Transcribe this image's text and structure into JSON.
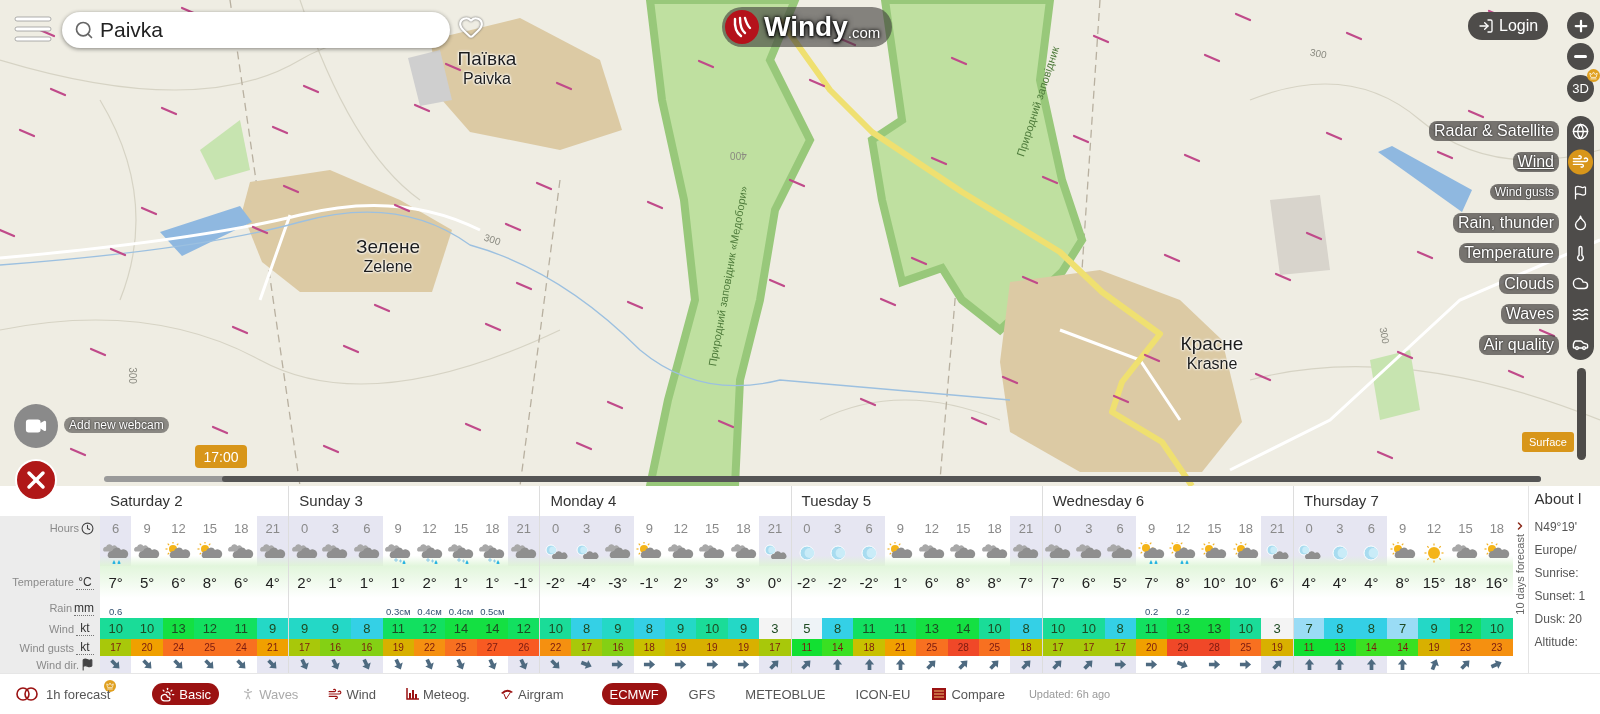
{
  "search": {
    "value": "Paivka"
  },
  "logo": {
    "name": "Windy",
    "suffix": ".com"
  },
  "login": {
    "label": "Login"
  },
  "three_d": {
    "label": "3D"
  },
  "layers": [
    {
      "label": "Radar & Satellite",
      "kind": "main",
      "selected": false
    },
    {
      "label": "Wind",
      "kind": "main",
      "selected": true
    },
    {
      "label": "Wind gusts",
      "kind": "sub",
      "selected": false
    },
    {
      "label": "Rain, thunder",
      "kind": "main",
      "selected": false
    },
    {
      "label": "Temperature",
      "kind": "main",
      "selected": false
    },
    {
      "label": "Clouds",
      "kind": "main",
      "selected": false
    },
    {
      "label": "Waves",
      "kind": "main",
      "selected": false
    },
    {
      "label": "Air quality",
      "kind": "main",
      "selected": false
    }
  ],
  "altitude": {
    "label": "Surface"
  },
  "webcam": {
    "label": "Add new webcam"
  },
  "time_bubble": {
    "label": "17:00"
  },
  "map_labels": {
    "places": [
      {
        "local": "Паївка",
        "latin": "Paivka"
      },
      {
        "local": "Зелене",
        "latin": "Zelene"
      },
      {
        "local": "Красне",
        "latin": "Krasne"
      }
    ],
    "contours": [
      "300",
      "300",
      "300",
      "400",
      "300"
    ],
    "reserves": [
      "Природний заповідник «Медобори»",
      "Природний заповідник"
    ]
  },
  "forecast": {
    "row_labels": [
      {
        "label": "Hours",
        "kind": "clock"
      },
      {
        "label": "Temperature",
        "kind": "unit",
        "unit": "°C"
      },
      {
        "label": "Rain",
        "kind": "unit",
        "unit": "mm"
      },
      {
        "label": "Wind",
        "kind": "unit",
        "unit": "kt"
      },
      {
        "label": "Wind gusts",
        "kind": "unit",
        "unit": "kt"
      },
      {
        "label": "Wind dir.",
        "kind": "flag"
      }
    ],
    "more_link": "10 days forecast",
    "days": [
      {
        "label": "Saturday 2",
        "hours": [
          {
            "hour": "6",
            "weather": {
              "kind": "rain"
            },
            "temp": "7°",
            "rain": "0.6",
            "wind": "10",
            "gust": "17",
            "dir": {
              "kind": "SE"
            },
            "night": true
          },
          {
            "hour": "9",
            "weather": {
              "kind": "cloud"
            },
            "temp": "5°",
            "wind": "10",
            "gust": "20",
            "dir": {
              "kind": "SE"
            },
            "night": false
          },
          {
            "hour": "12",
            "weather": {
              "kind": "sun-cloud"
            },
            "temp": "6°",
            "wind": "13",
            "gust": "24",
            "dir": {
              "kind": "SE"
            },
            "night": false
          },
          {
            "hour": "15",
            "weather": {
              "kind": "sun-cloud"
            },
            "temp": "8°",
            "wind": "12",
            "gust": "25",
            "dir": {
              "kind": "SE"
            },
            "night": false
          },
          {
            "hour": "18",
            "weather": {
              "kind": "cloud"
            },
            "temp": "6°",
            "wind": "11",
            "gust": "24",
            "dir": {
              "kind": "SE"
            },
            "night": false
          },
          {
            "hour": "21",
            "weather": {
              "kind": "cloud"
            },
            "temp": "4°",
            "wind": "9",
            "gust": "21",
            "dir": {
              "kind": "SE"
            },
            "night": true
          }
        ]
      },
      {
        "label": "Sunday 3",
        "hours": [
          {
            "hour": "0",
            "weather": {
              "kind": "cloud"
            },
            "temp": "2°",
            "wind": "9",
            "gust": "17",
            "dir": {
              "kind": "SSE"
            },
            "night": true
          },
          {
            "hour": "3",
            "weather": {
              "kind": "cloud"
            },
            "temp": "1°",
            "wind": "9",
            "gust": "16",
            "dir": {
              "kind": "SSE"
            },
            "night": true
          },
          {
            "hour": "6",
            "weather": {
              "kind": "cloud"
            },
            "temp": "1°",
            "wind": "8",
            "gust": "16",
            "dir": {
              "kind": "SSE"
            },
            "night": true
          },
          {
            "hour": "9",
            "weather": {
              "kind": "sleet"
            },
            "temp": "1°",
            "rain": "0.3см",
            "wind": "11",
            "gust": "19",
            "dir": {
              "kind": "SSE"
            },
            "night": false
          },
          {
            "hour": "12",
            "weather": {
              "kind": "sleet"
            },
            "temp": "2°",
            "rain": "0.4см",
            "wind": "12",
            "gust": "22",
            "dir": {
              "kind": "SSE"
            },
            "night": false
          },
          {
            "hour": "15",
            "weather": {
              "kind": "sleet"
            },
            "temp": "1°",
            "rain": "0.4см",
            "wind": "14",
            "gust": "25",
            "dir": {
              "kind": "SSE"
            },
            "night": false
          },
          {
            "hour": "18",
            "weather": {
              "kind": "sleet"
            },
            "temp": "1°",
            "rain": "0.5см",
            "wind": "14",
            "gust": "27",
            "dir": {
              "kind": "SSE"
            },
            "night": false
          },
          {
            "hour": "21",
            "weather": {
              "kind": "cloud"
            },
            "temp": "-1°",
            "wind": "12",
            "gust": "26",
            "dir": {
              "kind": "SSE"
            },
            "night": true
          }
        ]
      },
      {
        "label": "Monday 4",
        "hours": [
          {
            "hour": "0",
            "weather": {
              "kind": "moon-cloud"
            },
            "temp": "-2°",
            "wind": "10",
            "gust": "22",
            "dir": {
              "kind": "SE"
            },
            "night": true
          },
          {
            "hour": "3",
            "weather": {
              "kind": "moon-cloud"
            },
            "temp": "-4°",
            "wind": "8",
            "gust": "17",
            "dir": {
              "kind": "ESE"
            },
            "night": true
          },
          {
            "hour": "6",
            "weather": {
              "kind": "cloud"
            },
            "temp": "-3°",
            "wind": "9",
            "gust": "16",
            "dir": {
              "kind": "E"
            },
            "night": true
          },
          {
            "hour": "9",
            "weather": {
              "kind": "sun-cloud"
            },
            "temp": "-1°",
            "wind": "8",
            "gust": "18",
            "dir": {
              "kind": "E"
            },
            "night": false
          },
          {
            "hour": "12",
            "weather": {
              "kind": "cloud"
            },
            "temp": "2°",
            "wind": "9",
            "gust": "19",
            "dir": {
              "kind": "E"
            },
            "night": false
          },
          {
            "hour": "15",
            "weather": {
              "kind": "cloud"
            },
            "temp": "3°",
            "wind": "10",
            "gust": "19",
            "dir": {
              "kind": "E"
            },
            "night": false
          },
          {
            "hour": "18",
            "weather": {
              "kind": "cloud"
            },
            "temp": "3°",
            "wind": "9",
            "gust": "19",
            "dir": {
              "kind": "E"
            },
            "night": false
          },
          {
            "hour": "21",
            "weather": {
              "kind": "moon-cloud"
            },
            "temp": "0°",
            "wind": "3",
            "gust": "17",
            "dir": {
              "kind": "NE"
            },
            "night": true
          }
        ]
      },
      {
        "label": "Tuesday 5",
        "hours": [
          {
            "hour": "0",
            "weather": {
              "kind": "moon"
            },
            "temp": "-2°",
            "wind": "5",
            "gust": "11",
            "dir": {
              "kind": "NE"
            },
            "night": true
          },
          {
            "hour": "3",
            "weather": {
              "kind": "moon"
            },
            "temp": "-2°",
            "wind": "8",
            "gust": "14",
            "dir": {
              "kind": "N"
            },
            "night": true
          },
          {
            "hour": "6",
            "weather": {
              "kind": "moon"
            },
            "temp": "-2°",
            "wind": "11",
            "gust": "18",
            "dir": {
              "kind": "N"
            },
            "night": true
          },
          {
            "hour": "9",
            "weather": {
              "kind": "sun-cloud"
            },
            "temp": "1°",
            "wind": "11",
            "gust": "21",
            "dir": {
              "kind": "N"
            },
            "night": false
          },
          {
            "hour": "12",
            "weather": {
              "kind": "cloud"
            },
            "temp": "6°",
            "wind": "13",
            "gust": "25",
            "dir": {
              "kind": "NE"
            },
            "night": false
          },
          {
            "hour": "15",
            "weather": {
              "kind": "cloud"
            },
            "temp": "8°",
            "wind": "14",
            "gust": "28",
            "dir": {
              "kind": "NE"
            },
            "night": false
          },
          {
            "hour": "18",
            "weather": {
              "kind": "cloud"
            },
            "temp": "8°",
            "wind": "10",
            "gust": "25",
            "dir": {
              "kind": "NE"
            },
            "night": false
          },
          {
            "hour": "21",
            "weather": {
              "kind": "cloud"
            },
            "temp": "7°",
            "wind": "8",
            "gust": "18",
            "dir": {
              "kind": "NE"
            },
            "night": true
          }
        ]
      },
      {
        "label": "Wednesday 6",
        "hours": [
          {
            "hour": "0",
            "weather": {
              "kind": "cloud"
            },
            "temp": "7°",
            "wind": "10",
            "gust": "17",
            "dir": {
              "kind": "NE"
            },
            "night": true
          },
          {
            "hour": "3",
            "weather": {
              "kind": "cloud"
            },
            "temp": "6°",
            "wind": "10",
            "gust": "17",
            "dir": {
              "kind": "NE"
            },
            "night": true
          },
          {
            "hour": "6",
            "weather": {
              "kind": "cloud"
            },
            "temp": "5°",
            "wind": "8",
            "gust": "17",
            "dir": {
              "kind": "E"
            },
            "night": true
          },
          {
            "hour": "9",
            "weather": {
              "kind": "sun-rain"
            },
            "temp": "7°",
            "rain": "0.2",
            "wind": "11",
            "gust": "20",
            "dir": {
              "kind": "E"
            },
            "night": false
          },
          {
            "hour": "12",
            "weather": {
              "kind": "sun-rain"
            },
            "temp": "8°",
            "rain": "0.2",
            "wind": "13",
            "gust": "29",
            "dir": {
              "kind": "ESE"
            },
            "night": false
          },
          {
            "hour": "15",
            "weather": {
              "kind": "sun-cloud"
            },
            "temp": "10°",
            "wind": "13",
            "gust": "28",
            "dir": {
              "kind": "E"
            },
            "night": false
          },
          {
            "hour": "18",
            "weather": {
              "kind": "sun-cloud"
            },
            "temp": "10°",
            "wind": "10",
            "gust": "25",
            "dir": {
              "kind": "E"
            },
            "night": false
          },
          {
            "hour": "21",
            "weather": {
              "kind": "moon-cloud"
            },
            "temp": "6°",
            "wind": "3",
            "gust": "19",
            "dir": {
              "kind": "NE"
            },
            "night": true
          }
        ]
      },
      {
        "label": "Thursday 7",
        "hours": [
          {
            "hour": "0",
            "weather": {
              "kind": "moon-cloud"
            },
            "temp": "4°",
            "wind": "7",
            "gust": "11",
            "dir": {
              "kind": "N"
            },
            "night": true
          },
          {
            "hour": "3",
            "weather": {
              "kind": "moon"
            },
            "temp": "4°",
            "wind": "8",
            "gust": "13",
            "dir": {
              "kind": "N"
            },
            "night": true
          },
          {
            "hour": "6",
            "weather": {
              "kind": "moon"
            },
            "temp": "4°",
            "wind": "8",
            "gust": "14",
            "dir": {
              "kind": "N"
            },
            "night": true
          },
          {
            "hour": "9",
            "weather": {
              "kind": "sun-cloud"
            },
            "temp": "8°",
            "wind": "7",
            "gust": "14",
            "dir": {
              "kind": "N"
            },
            "night": false
          },
          {
            "hour": "12",
            "weather": {
              "kind": "sun"
            },
            "temp": "15°",
            "wind": "9",
            "gust": "19",
            "dir": {
              "kind": "NNE"
            },
            "night": false
          },
          {
            "hour": "15",
            "weather": {
              "kind": "cloud"
            },
            "temp": "18°",
            "wind": "12",
            "gust": "23",
            "dir": {
              "kind": "NE"
            },
            "night": false
          },
          {
            "hour": "18",
            "weather": {
              "kind": "sun-cloud"
            },
            "temp": "16°",
            "wind": "10",
            "gust": "23",
            "dir": {
              "kind": "ENE"
            },
            "night": false
          }
        ]
      }
    ]
  },
  "about": {
    "title": "About l",
    "lines": [
      "N49°19'",
      "Europe/",
      "Sunrise:",
      "Sunset: 1",
      "Dusk: 20",
      "Altitude:"
    ]
  },
  "bottom_bar": {
    "hourly": {
      "label": "1h forecast",
      "on": false
    },
    "views": [
      {
        "label": "Basic",
        "selected": true,
        "disabled": false
      },
      {
        "label": "Waves",
        "selected": false,
        "disabled": true
      },
      {
        "label": "Wind",
        "selected": false,
        "disabled": false
      },
      {
        "label": "Meteog.",
        "selected": false,
        "disabled": false
      },
      {
        "label": "Airgram",
        "selected": false,
        "disabled": false
      }
    ],
    "models": [
      {
        "label": "ECMWF",
        "selected": true
      },
      {
        "label": "GFS",
        "selected": false
      },
      {
        "label": "METEOBLUE",
        "selected": false
      },
      {
        "label": "ICON-EU",
        "selected": false
      }
    ],
    "compare": "Compare",
    "updated": "Updated: 6h ago"
  }
}
